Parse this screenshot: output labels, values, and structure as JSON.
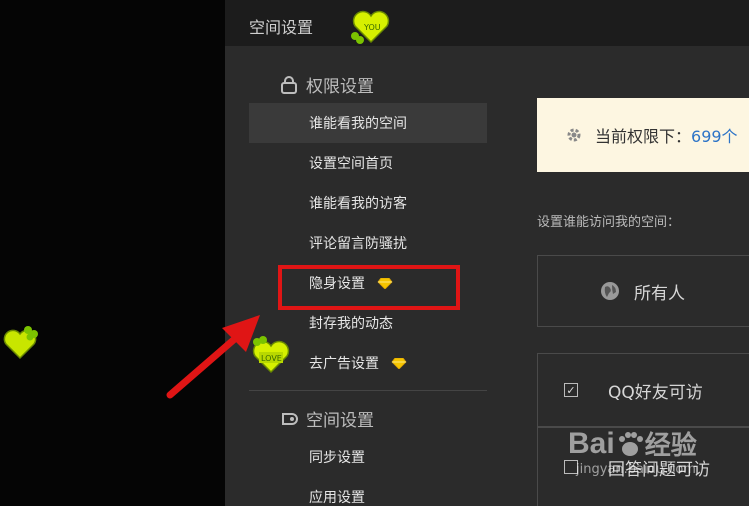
{
  "window": {
    "title": "空间设置"
  },
  "sidebar": {
    "sections": [
      {
        "title": "权限设置",
        "icon": "lock-icon"
      },
      {
        "title": "空间设置",
        "icon": "settings-icon"
      }
    ],
    "items": [
      {
        "label": "谁能看我的空间",
        "active": true
      },
      {
        "label": "设置空间首页"
      },
      {
        "label": "谁能看我的访客"
      },
      {
        "label": "评论留言防骚扰"
      },
      {
        "label": "隐身设置",
        "badge": "diamond-icon"
      },
      {
        "label": "封存我的动态"
      },
      {
        "label": "去广告设置",
        "badge": "diamond-icon"
      },
      {
        "label": "同步设置"
      },
      {
        "label": "应用设置"
      }
    ]
  },
  "main": {
    "notice": {
      "text": "当前权限下：",
      "count": "699个"
    },
    "subtitle": "设置谁能访问我的空间：",
    "options": [
      {
        "label": "所有人",
        "icon": "globe-icon"
      },
      {
        "label": "QQ好友可访",
        "checked": true
      },
      {
        "label": "回答问题可访",
        "checked": false
      }
    ]
  },
  "stickers": {
    "love": "LOVE",
    "you": "YOU"
  },
  "watermark": {
    "brand": "Bai",
    "brand2": "经验",
    "url": "jingyan.baidu.com"
  },
  "colors": {
    "highlight": "#e01515",
    "notice_bg": "#fdf6e1",
    "link": "#2d74c7",
    "gem": "#f5c400"
  }
}
